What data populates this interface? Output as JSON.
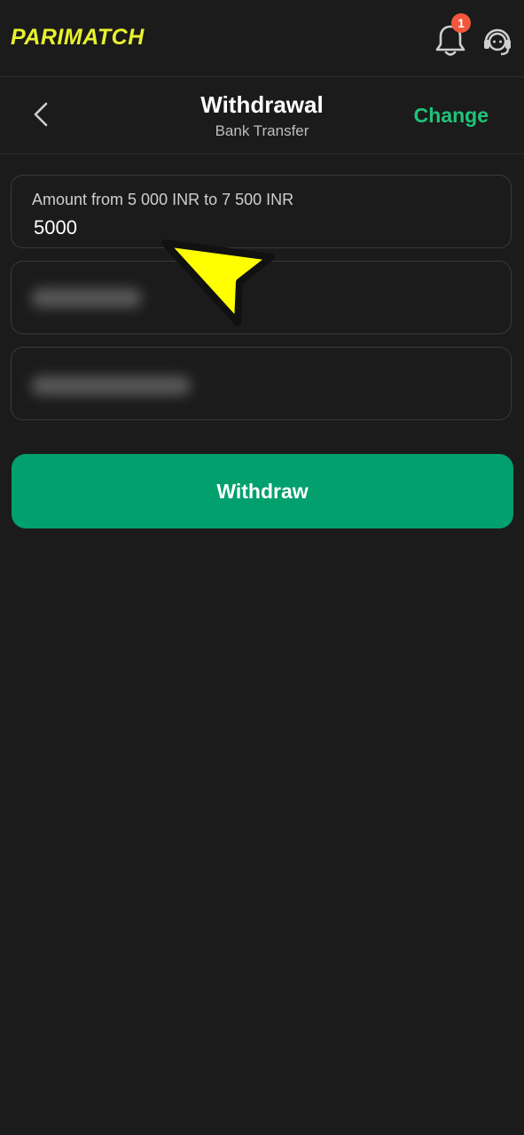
{
  "header": {
    "logo_text": "PARIMATCH",
    "notification_count": "1",
    "icons": {
      "notifications": "bell-icon",
      "support": "headset-icon"
    }
  },
  "subheader": {
    "title": "Withdrawal",
    "subtitle": "Bank Transfer",
    "change_label": "Change",
    "back_icon": "chevron-left-icon"
  },
  "form": {
    "amount_label": "Amount from 5 000 INR to 7 500 INR",
    "amount_value": "5000",
    "withdraw_label": "Withdraw"
  },
  "colors": {
    "background": "#1b1b1b",
    "brand_yellow": "#e8f22d",
    "accent_green": "#1ec47a",
    "button_green": "#01a06d",
    "badge_red": "#f2573c",
    "pointer_yellow": "#ffff00"
  }
}
